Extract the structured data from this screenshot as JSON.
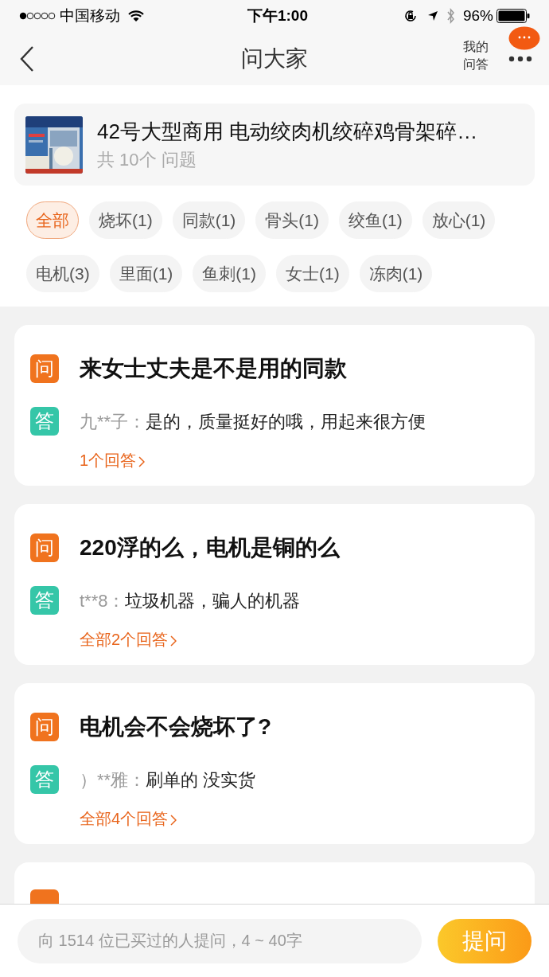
{
  "status_bar": {
    "carrier": "中国移动",
    "time": "下午1:00",
    "battery": "96%"
  },
  "nav": {
    "title": "问大家",
    "my_answers": [
      "我的",
      "问答"
    ]
  },
  "product": {
    "title": "42号大型商用 电动绞肉机绞碎鸡骨架碎…",
    "count": "共 10个 问题"
  },
  "tags": [
    {
      "label": "全部",
      "selected": true
    },
    {
      "label": "烧坏(1)",
      "selected": false
    },
    {
      "label": "同款(1)",
      "selected": false
    },
    {
      "label": "骨头(1)",
      "selected": false
    },
    {
      "label": "绞鱼(1)",
      "selected": false
    },
    {
      "label": "放心(1)",
      "selected": false
    },
    {
      "label": "电机(3)",
      "selected": false
    },
    {
      "label": "里面(1)",
      "selected": false
    },
    {
      "label": "鱼刺(1)",
      "selected": false
    },
    {
      "label": "女士(1)",
      "selected": false
    },
    {
      "label": "冻肉(1)",
      "selected": false
    }
  ],
  "questions": [
    {
      "q_badge": "问",
      "title": "来女士丈夫是不是用的同款",
      "a_badge": "答",
      "user": "九**子：",
      "answer": "是的，质量挺好的哦，用起来很方便",
      "link": "1个回答"
    },
    {
      "q_badge": "问",
      "title": "220浮的么，电机是铜的么",
      "a_badge": "答",
      "user": "t**8：",
      "answer": "垃圾机器，骗人的机器",
      "link": "全部2个回答"
    },
    {
      "q_badge": "问",
      "title": "电机会不会烧坏了?",
      "a_badge": "答",
      "user": "）**雅：",
      "answer": "刷单的 没实货",
      "link": "全部4个回答"
    }
  ],
  "bottom_bar": {
    "placeholder": "向 1514 位已买过的人提问，4 ~ 40字",
    "button": "提问"
  }
}
